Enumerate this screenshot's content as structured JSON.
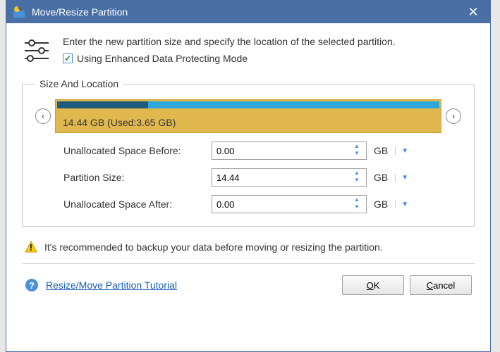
{
  "titlebar": {
    "title": "Move/Resize Partition"
  },
  "header": {
    "instruction": "Enter the new partition size and specify the location of the selected partition.",
    "checkbox_label": "Using Enhanced Data Protecting Mode",
    "checkbox_checked": true
  },
  "fieldset": {
    "legend": "Size And Location"
  },
  "partition": {
    "total_gb": "14.44",
    "used_gb": "3.65",
    "label": "14.44 GB (Used:3.65 GB)",
    "used_percent": 25.3
  },
  "fields": {
    "before_label": "Unallocated Space Before:",
    "before_value": "0.00",
    "size_label": "Partition Size:",
    "size_value": "14.44",
    "after_label": "Unallocated Space After:",
    "after_value": "0.00",
    "unit": "GB"
  },
  "warning": "It's recommended to backup your data before moving or resizing the partition.",
  "footer": {
    "tutorial_link": "Resize/Move Partition Tutorial",
    "ok": "OK",
    "cancel": "Cancel"
  }
}
